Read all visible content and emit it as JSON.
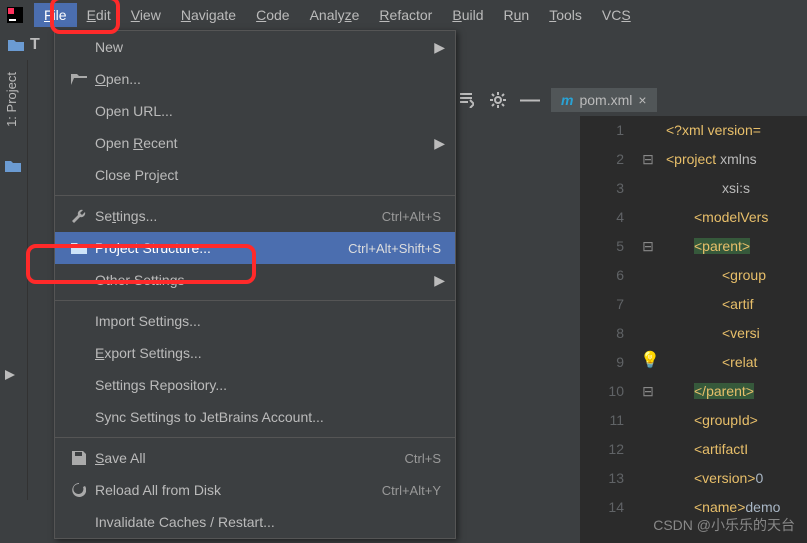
{
  "menubar": {
    "items": [
      {
        "label": "File",
        "mn": "F",
        "active": true
      },
      {
        "label": "Edit",
        "mn": "E"
      },
      {
        "label": "View",
        "mn": "V"
      },
      {
        "label": "Navigate",
        "mn": "N"
      },
      {
        "label": "Code",
        "mn": "C"
      },
      {
        "label": "Analyze",
        "mn": "z"
      },
      {
        "label": "Refactor",
        "mn": "R"
      },
      {
        "label": "Build",
        "mn": "B"
      },
      {
        "label": "Run",
        "mn": "u"
      },
      {
        "label": "Tools",
        "mn": "T"
      },
      {
        "label": "VCS",
        "mn": "S"
      }
    ]
  },
  "toolbar_project_label": "T",
  "left_rail": {
    "project_tab": "1: Project"
  },
  "dropdown": {
    "new": "New",
    "open": "Open...",
    "open_url": "Open URL...",
    "open_recent": "Open Recent",
    "close_project": "Close Project",
    "settings": "Settings...",
    "settings_sc": "Ctrl+Alt+S",
    "project_structure": "Project Structure...",
    "project_structure_sc": "Ctrl+Alt+Shift+S",
    "other_settings": "Other Settings",
    "import_settings": "Import Settings...",
    "export_settings": "Export Settings...",
    "settings_repo": "Settings Repository...",
    "sync_settings": "Sync Settings to JetBrains Account...",
    "save_all": "Save All",
    "save_all_sc": "Ctrl+S",
    "reload_disk": "Reload All from Disk",
    "reload_disk_sc": "Ctrl+Alt+Y",
    "invalidate": "Invalidate Caches / Restart..."
  },
  "editor_tab": {
    "filename": "pom.xml"
  },
  "gutter_lines": [
    "1",
    "2",
    "3",
    "4",
    "5",
    "6",
    "7",
    "8",
    "9",
    "10",
    "11",
    "12",
    "13",
    "14"
  ],
  "code_lines": {
    "l1": "<?xml version=",
    "l2a": "<project",
    "l2b": " xmlns",
    "l3": "xsi:s",
    "l4": "<modelVers",
    "l5": "<parent>",
    "l6": "<group",
    "l7": "<artif",
    "l8": "<versi",
    "l9": "<relat",
    "l10": "</parent>",
    "l11": "<groupId>",
    "l12": "<artifactI",
    "l13a": "<version>",
    "l13b": "0",
    "l14a": "<name>",
    "l14b": "demo"
  },
  "watermark": "CSDN @小乐乐的天台"
}
